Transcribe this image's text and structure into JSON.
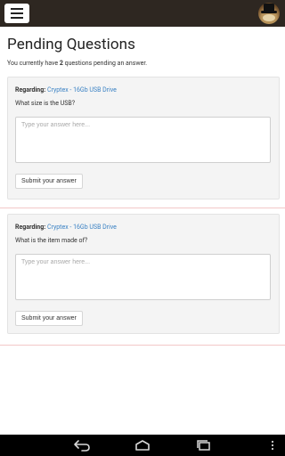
{
  "app": {
    "menu_icon": "hamburger-menu-icon",
    "avatar": "profile-avatar"
  },
  "page": {
    "title": "Pending Questions",
    "subtitle_prefix": "You currently have",
    "pending_count": "2",
    "subtitle_suffix": "questions pending an answer."
  },
  "questions": [
    {
      "regarding_label": "Regarding:",
      "product": "Cryptex - 16Gb USB Drive",
      "question": "What size is the USB?",
      "answer_placeholder": "Type your answer here...",
      "submit_label": "Submit your answer"
    },
    {
      "regarding_label": "Regarding:",
      "product": "Cryptex - 16Gb USB Drive",
      "question": "What is the item made of?",
      "answer_placeholder": "Type your answer here...",
      "submit_label": "Submit your answer"
    }
  ],
  "system_nav": {
    "back_icon": "back-icon",
    "home_icon": "home-icon",
    "recent_icon": "recent-apps-icon",
    "overflow_icon": "overflow-menu-icon"
  },
  "colors": {
    "topbar": "#2e2721",
    "link": "#3b82c4",
    "card_bg": "#f4f4f4",
    "separator": "#f3c8c8"
  }
}
